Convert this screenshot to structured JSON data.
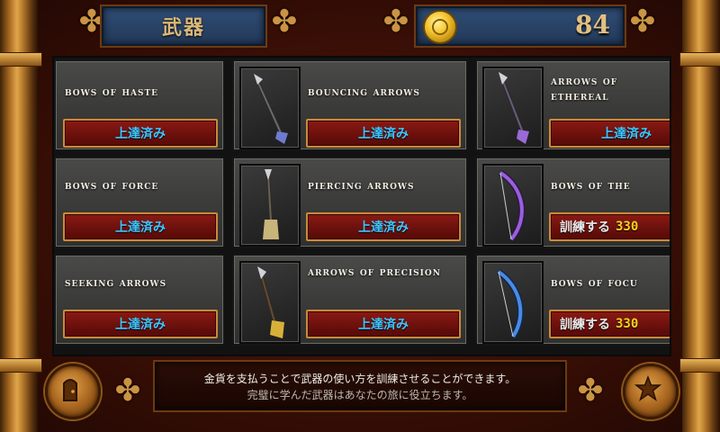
{
  "header": {
    "title": "武器",
    "coins": "84",
    "coin_icon": "gold-coin-icon"
  },
  "weapons": [
    {
      "name": "bows of haste",
      "status": "上達済み",
      "state": "mastered"
    },
    {
      "name": "bouncing arrows",
      "status": "上達済み",
      "state": "mastered",
      "icon": "arrow-icon",
      "color": "#6f7bd0"
    },
    {
      "name": "arrows of ethereal",
      "status": "上達済み",
      "state": "mastered",
      "icon": "arrow-icon",
      "color": "#9a6ad8"
    },
    {
      "name": "bows of force",
      "status": "上達済み",
      "state": "mastered"
    },
    {
      "name": "piercing arrows",
      "status": "上達済み",
      "state": "mastered",
      "icon": "arrow-icon",
      "color": "#c9b47a"
    },
    {
      "name": "bows of the",
      "status": "訓練する",
      "price": "330",
      "state": "trainable",
      "icon": "bow-icon",
      "color": "#9a5ee0"
    },
    {
      "name": "seeking arrows",
      "status": "上達済み",
      "state": "mastered"
    },
    {
      "name": "arrows of precision",
      "status": "上達済み",
      "state": "mastered",
      "icon": "arrow-icon",
      "color": "#d7b03a"
    },
    {
      "name": "bows of focu",
      "status": "訓練する",
      "price": "330",
      "state": "trainable",
      "icon": "bow-icon",
      "color": "#4a8ae8"
    }
  ],
  "footer": {
    "line1": "金貨を支払うことで武器の使い方を訓練させることができます。",
    "line2": "完璧に学んだ武器はあなたの旅に役立ちます。"
  },
  "buttons": {
    "left_icon": "door-exit-icon",
    "right_icon": "star-icon"
  },
  "colors": {
    "mastered_text": "#3ec6ff",
    "price_text": "#f5d21a",
    "button_bg": "#6a100c",
    "panel_blue": "#2f4d74"
  }
}
